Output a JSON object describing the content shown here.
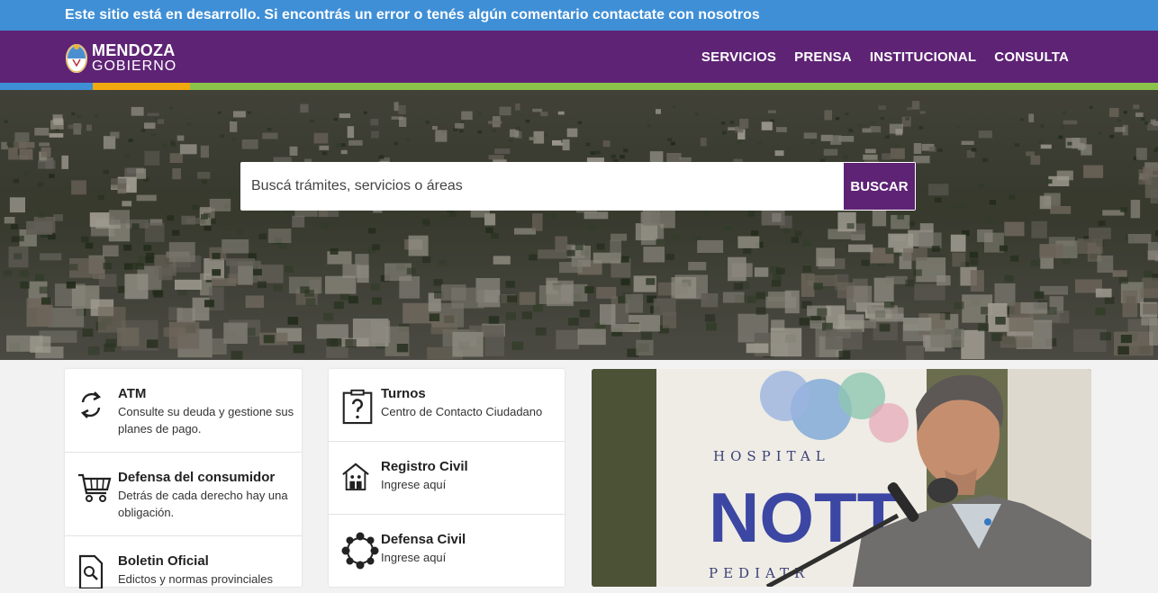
{
  "banner": {
    "text": "Este sitio está en desarrollo. Si encontrás un error o tenés algún comentario contactate con nosotros"
  },
  "header": {
    "logo_line1": "MENDOZA",
    "logo_line2": "GOBIERNO",
    "nav": [
      "SERVICIOS",
      "PRENSA",
      "INSTITUCIONAL",
      "CONSULTA"
    ]
  },
  "colors": {
    "banner": "#3f8fd6",
    "brand_purple": "#5e2375",
    "stripe_blue": "#3f8fd6",
    "stripe_yellow": "#f2a80f",
    "stripe_green": "#8bc34a"
  },
  "search": {
    "placeholder": "Buscá trámites, servicios o áreas",
    "button": "BUSCAR"
  },
  "cards_left": [
    {
      "title": "ATM",
      "desc": "Consulte su deuda y gestione sus planes de pago.",
      "icon": "sync-arrows-icon"
    },
    {
      "title": "Defensa del consumidor",
      "desc": "Detrás de cada derecho hay una obligación.",
      "icon": "shopping-cart-icon"
    },
    {
      "title": "Boletin Oficial",
      "desc": "Edictos y normas provinciales",
      "icon": "document-search-icon"
    }
  ],
  "cards_mid": [
    {
      "title": "Turnos",
      "desc": "Centro de Contacto Ciudadano",
      "icon": "clipboard-question-icon"
    },
    {
      "title": "Registro Civil",
      "desc": "Ingrese aquí",
      "icon": "house-family-icon"
    },
    {
      "title": "Defensa Civil",
      "desc": "Ingrese aquí",
      "icon": "people-circle-icon"
    }
  ],
  "photo": {
    "sign_line1": "HOSPITAL",
    "sign_line2": "NOTT",
    "sign_line3": "PEDIATR"
  }
}
